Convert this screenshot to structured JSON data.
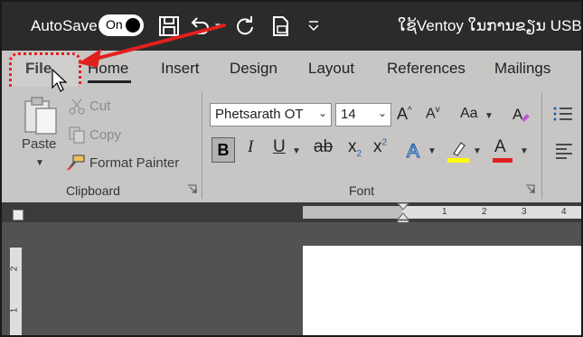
{
  "titlebar": {
    "autosave_label": "AutoSave",
    "toggle_label": "On",
    "document_title": "ໃຊ້Ventoy ໃນການຂຽນ USB W"
  },
  "tabs": [
    {
      "label": "File"
    },
    {
      "label": "Home"
    },
    {
      "label": "Insert"
    },
    {
      "label": "Design"
    },
    {
      "label": "Layout"
    },
    {
      "label": "References"
    },
    {
      "label": "Mailings"
    }
  ],
  "clipboard": {
    "paste_label": "Paste",
    "cut_label": "Cut",
    "copy_label": "Copy",
    "format_painter_label": "Format Painter",
    "group_label": "Clipboard"
  },
  "font": {
    "font_name": "Phetsarath OT",
    "font_size": "14",
    "grow_label": "A",
    "shrink_label": "A",
    "case_label": "Aa",
    "bold_label": "B",
    "italic_label": "I",
    "underline_label": "U",
    "strike_label": "ab",
    "subscript_label": "x",
    "subscript_mark": "2",
    "superscript_label": "x",
    "superscript_mark": "2",
    "font_color_label": "A",
    "group_label": "Font"
  },
  "ruler": {
    "numbers": [
      "2",
      "1",
      "1",
      "2",
      "3",
      "4"
    ],
    "vertical_numbers": [
      "2",
      "1"
    ]
  },
  "colors": {
    "titlebar_bg": "#2b2b2b",
    "ribbon_bg": "#c8c6c4",
    "highlight_yellow": "#ffff00",
    "font_color_red": "#e02020",
    "annotation_red": "#e0201e"
  }
}
